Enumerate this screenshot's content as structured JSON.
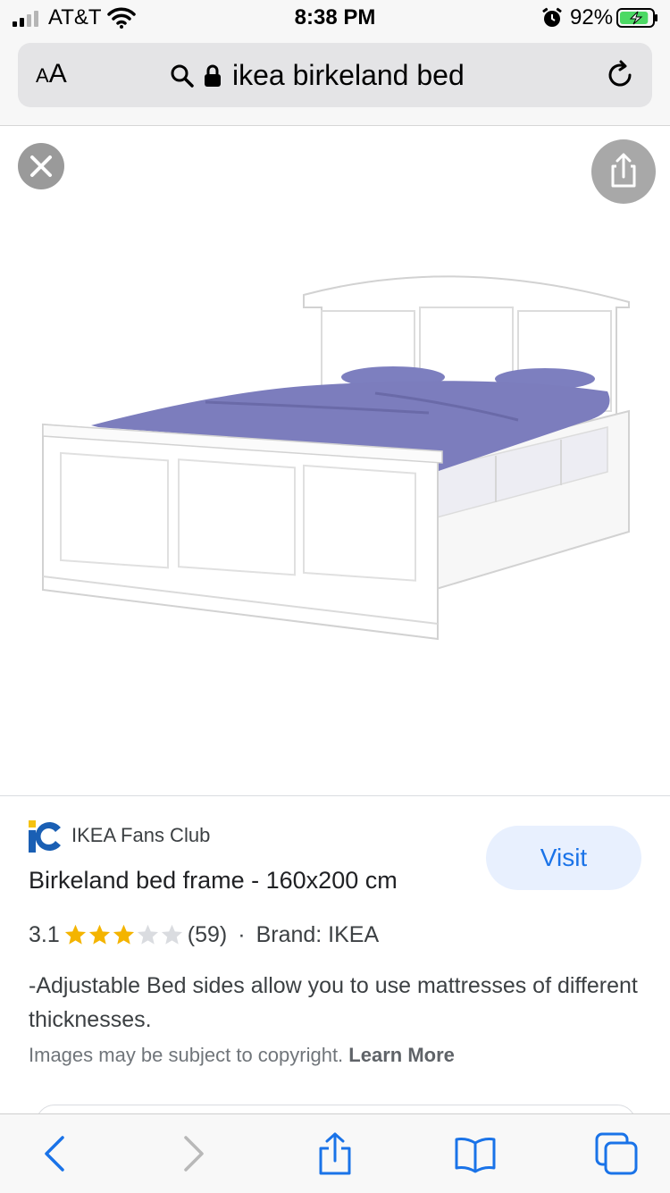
{
  "status_bar": {
    "carrier": "AT&T",
    "time": "8:38 PM",
    "battery_percent": "92%",
    "battery_level": 0.92,
    "icons": [
      "signal-icon",
      "wifi-icon",
      "alarm-icon",
      "battery-icon"
    ]
  },
  "address_bar": {
    "aa_label_small": "A",
    "aa_label_large": "A",
    "query": "ikea birkeland bed",
    "icons": [
      "search-icon",
      "lock-icon",
      "reload-icon"
    ]
  },
  "viewer": {
    "icons": [
      "close-icon",
      "share-icon"
    ],
    "image_alt": "White bed frame with lilac bedding"
  },
  "result": {
    "source": "IKEA Fans Club",
    "visit_label": "Visit",
    "title": "Birkeland bed frame - 160x200 cm",
    "rating_value": "3.1",
    "rating_stars": 3,
    "rating_max": 5,
    "rating_count": "(59)",
    "separator": "·",
    "brand": "Brand: IKEA",
    "description": "-Adjustable Bed sides allow you to use mattresses of different thicknesses.",
    "copyright_text": "Images may be subject to copyright.",
    "learn_more": "Learn More"
  },
  "toolbar": {
    "icons": [
      "back-icon",
      "forward-icon",
      "share-icon",
      "bookmarks-icon",
      "tabs-icon"
    ]
  },
  "colors": {
    "accent_blue": "#1a73e8",
    "visit_bg": "#e8f0fe",
    "star_filled": "#f4b400",
    "star_empty": "#dadce0",
    "bedding": "#7d7fbf",
    "battery_green": "#4cd964"
  }
}
